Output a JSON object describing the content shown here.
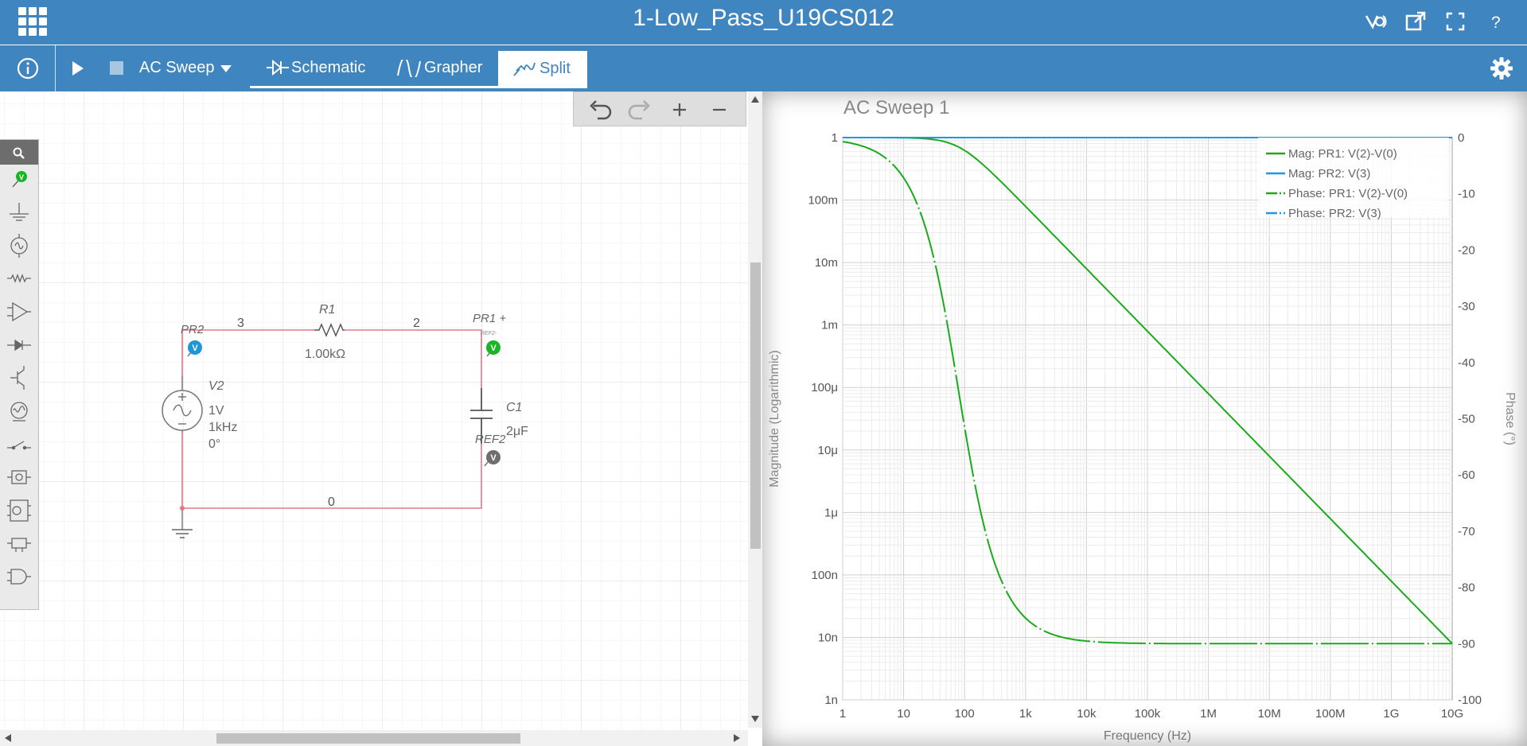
{
  "header": {
    "title": "1-Low_Pass_U19CS012"
  },
  "toolbar": {
    "analysis": "AC Sweep",
    "tabs": [
      {
        "label": "Schematic"
      },
      {
        "label": "Grapher"
      },
      {
        "label": "Split"
      }
    ],
    "active_tab": "Split"
  },
  "colors": {
    "accent": "#3f85c0",
    "wire": "#e07a86",
    "probe_green": "#19b526",
    "probe_blue": "#1f96d6",
    "probe_gray": "#6e6e6e",
    "trace_green": "#1aab1a",
    "trace_blue": "#1f96e6"
  },
  "schematic": {
    "wires": {
      "node_3": "3",
      "node_2": "2",
      "node_0": "0"
    },
    "resistor": {
      "name": "R1",
      "value": "1.00kΩ"
    },
    "source": {
      "name": "V2",
      "amplitude": "1V",
      "frequency": "1kHz",
      "phase": "0°"
    },
    "capacitor": {
      "name": "C1",
      "value": "2μF"
    },
    "probes": {
      "pr2": "PR2",
      "pr1": "PR1 +",
      "ref2_small": "REF2-",
      "ref2": "REF2",
      "probe_glyph": "V"
    },
    "palette_icons": [
      "search-icon",
      "voltage-probe-icon",
      "ground-icon",
      "ac-source-icon",
      "resistor-icon",
      "opamp-icon",
      "diode-icon",
      "transistor-icon",
      "lamp-icon",
      "switch-icon",
      "digital-block-icon",
      "ic-block-icon",
      "connector-icon",
      "and-gate-icon"
    ]
  },
  "grapher": {
    "title": "AC Sweep 1",
    "chart_data": {
      "type": "line",
      "title": "AC Sweep 1",
      "xlabel": "Frequency (Hz)",
      "ylabel": "Magnitude (Logarithmic)",
      "y2label": "Phase (°)",
      "xscale": "log",
      "yscale": "log",
      "xlim": [
        1,
        10000000000
      ],
      "ylim": [
        1e-09,
        1
      ],
      "y2lim": [
        -100,
        0
      ],
      "x_ticks": [
        "1",
        "10",
        "100",
        "1k",
        "10k",
        "100k",
        "1M",
        "10M",
        "100M",
        "1G",
        "10G"
      ],
      "y_ticks": [
        "1",
        "100m",
        "10m",
        "1m",
        "100μ",
        "10μ",
        "1μ",
        "100n",
        "10n",
        "1n"
      ],
      "y2_ticks": [
        "0",
        "-10",
        "-20",
        "-30",
        "-40",
        "-50",
        "-60",
        "-70",
        "-80",
        "-90",
        "-100"
      ],
      "grid": true,
      "legend_position": "top-right",
      "series": [
        {
          "name": "Mag: PR1: V(2)-V(0)",
          "axis": "left",
          "style": "solid",
          "x": [
            1,
            10,
            79.6,
            1000,
            10000,
            100000,
            1000000,
            10000000,
            100000000,
            1000000000,
            10000000000
          ],
          "values": [
            1,
            1,
            0.707,
            0.0794,
            0.00796,
            0.000796,
            7.96e-05,
            7.96e-06,
            7.96e-07,
            7.96e-08,
            7.96e-09
          ]
        },
        {
          "name": "Mag: PR2: V(3)",
          "axis": "left",
          "style": "solid",
          "x": [
            1,
            10000000000
          ],
          "values": [
            1,
            1
          ]
        },
        {
          "name": "Phase: PR1: V(2)-V(0)",
          "axis": "right",
          "style": "dash-dot",
          "x": [
            1,
            10,
            30,
            79.6,
            200,
            1000,
            10000,
            100000,
            1000000,
            10000000000
          ],
          "values": [
            -0.7,
            -7.1,
            -20.7,
            -45,
            -68.3,
            -85.5,
            -89.5,
            -90,
            -90,
            -90
          ]
        },
        {
          "name": "Phase: PR2: V(3)",
          "axis": "right",
          "style": "dash-dot",
          "x": [
            1,
            10000000000
          ],
          "values": [
            0,
            0
          ]
        }
      ]
    }
  }
}
